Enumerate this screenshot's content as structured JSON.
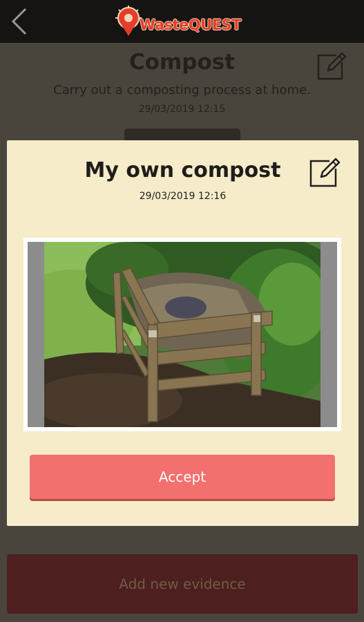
{
  "app": {
    "logo_text": "WasteQUEST"
  },
  "header": {
    "title": "Compost",
    "subtitle": "Carry out a composting process at home.",
    "date": "29/03/2019 12:15"
  },
  "modal": {
    "title": "My own compost",
    "date": "29/03/2019 12:16",
    "accept_label": "Accept"
  },
  "footer": {
    "add_evidence_label": "Add new evidence"
  },
  "icons": {
    "back": "chevron-left-icon",
    "edit": "edit-pencil-icon",
    "logo": "location-pin-icon"
  },
  "colors": {
    "accent": "#f2706e",
    "modal_bg": "#f6ecca",
    "add_button": "#4d1f1e",
    "logo_red": "#e53d2a"
  }
}
